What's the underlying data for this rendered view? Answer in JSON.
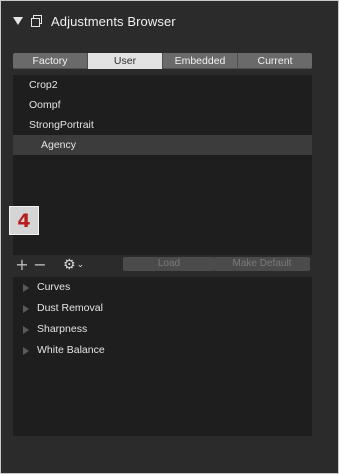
{
  "header": {
    "title": "Adjustments Browser"
  },
  "tabs": [
    {
      "label": "Factory",
      "active": false
    },
    {
      "label": "User",
      "active": true
    },
    {
      "label": "Embedded",
      "active": false
    },
    {
      "label": "Current",
      "active": false
    }
  ],
  "presets": [
    {
      "label": "Crop2",
      "selected": false
    },
    {
      "label": "Oompf",
      "selected": false
    },
    {
      "label": "StrongPortrait",
      "selected": false
    },
    {
      "label": "Agency",
      "selected": true
    }
  ],
  "annotation_badge": "4",
  "toolbar": {
    "add_symbol": "+",
    "remove_symbol": "−",
    "gear_icon": "gear-icon",
    "load_label": "Load",
    "make_default_label": "Make Default"
  },
  "adjustments": [
    {
      "label": "Curves"
    },
    {
      "label": "Dust Removal"
    },
    {
      "label": "Sharpness"
    },
    {
      "label": "White Balance"
    }
  ]
}
